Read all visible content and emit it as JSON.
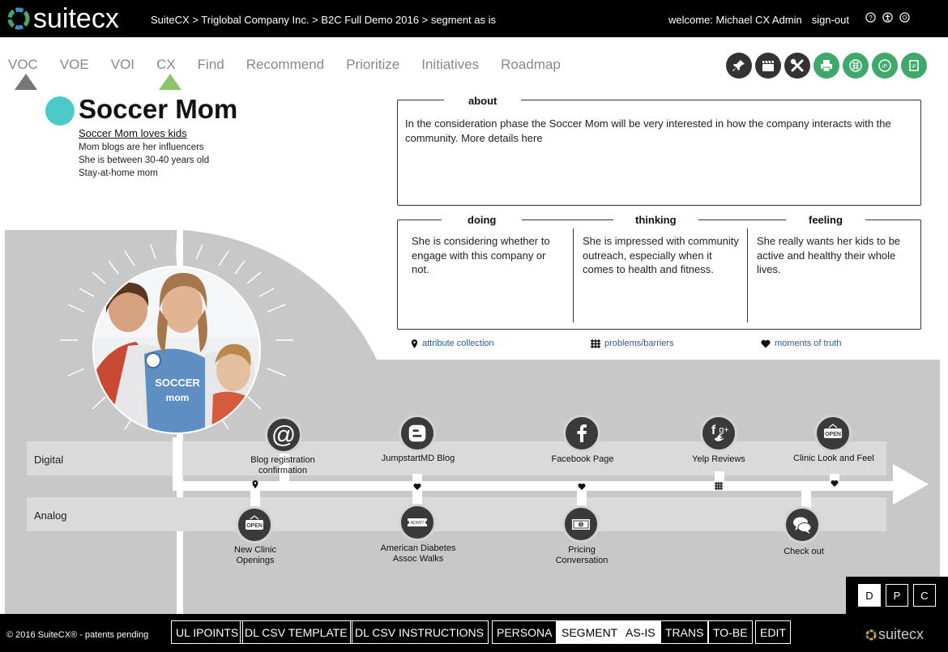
{
  "header": {
    "logo_text": "suitecx",
    "breadcrumb": [
      "SuiteCX",
      " > ",
      "Triglobal Company Inc.",
      " > ",
      "B2C Full Demo 2016",
      " > ",
      "segment as is"
    ],
    "welcome_label": "welcome: ",
    "user_name": "Michael CX Admin",
    "signout_label": "sign-out",
    "icons": [
      "help-icon",
      "accessibility-icon",
      "settings-icon"
    ]
  },
  "nav": {
    "items": [
      "VOC",
      "VOE",
      "VOI",
      "CX",
      "Find",
      "Recommend",
      "Prioritize",
      "Initiatives",
      "Roadmap"
    ],
    "active": "CX"
  },
  "toolbar": {
    "icons": [
      "pin-icon",
      "clapperboard-icon",
      "tools-icon",
      "print-icon",
      "grid-icon",
      "ip-export-icon",
      "ip-report-icon"
    ]
  },
  "persona": {
    "name": "Soccer Mom",
    "tagline": "Soccer Mom loves kids",
    "attributes": [
      "Mom blogs are her influencers",
      "She is between 30-40 years old",
      "Stay-at-home mom"
    ],
    "color": "#4cc9c9"
  },
  "about": {
    "title": "about",
    "text": "In the consideration phase the Soccer Mom will be very interested in how the company interacts with the community. More details here"
  },
  "dtf": {
    "doing_title": "doing",
    "doing_text": "She is considering whether to engage with this company or not.",
    "thinking_title": "thinking",
    "thinking_text": "She is impressed with community outreach, especially when it comes to health and fitness.",
    "feeling_title": "feeling",
    "feeling_text": "She really wants her kids to be active and healthy their whole lives."
  },
  "legend": {
    "attribute": "attribute collection",
    "problems": "problems/barriers",
    "moments": "moments of truth"
  },
  "lanes": {
    "digital": "Digital",
    "analog": "Analog"
  },
  "touchpoints": {
    "blog_registration": "Blog registration confirmation",
    "jumpstart_blog": "JumpstartMD Blog",
    "facebook_page": "Facebook Page",
    "yelp_reviews": "Yelp Reviews",
    "clinic_look": "Clinic Look and Feel",
    "new_clinic": "New Clinic Openings",
    "diabetes_walks": "American Diabetes Assoc Walks",
    "pricing": "Pricing Conversation",
    "checkout": "Check out"
  },
  "view_toggle": {
    "options": [
      "D",
      "P",
      "C"
    ],
    "active": "D"
  },
  "footer": {
    "copyright": "© 2016 SuiteCX® - patents pending",
    "buttons": [
      "UL IPOINTS",
      "DL CSV TEMPLATE",
      "DL CSV INSTRUCTIONS",
      "PERSONA",
      "SEGMENT",
      "AS-IS",
      "TRANS",
      "TO-BE",
      "EDIT"
    ],
    "active": [
      "SEGMENT",
      "AS-IS"
    ],
    "logo_text": "suitecx"
  },
  "colors": {
    "accent_green": "#3fa86b",
    "persona_teal": "#4cc9c9",
    "link_blue": "#2b5aa6",
    "stage_gray": "#c8c8c8"
  }
}
